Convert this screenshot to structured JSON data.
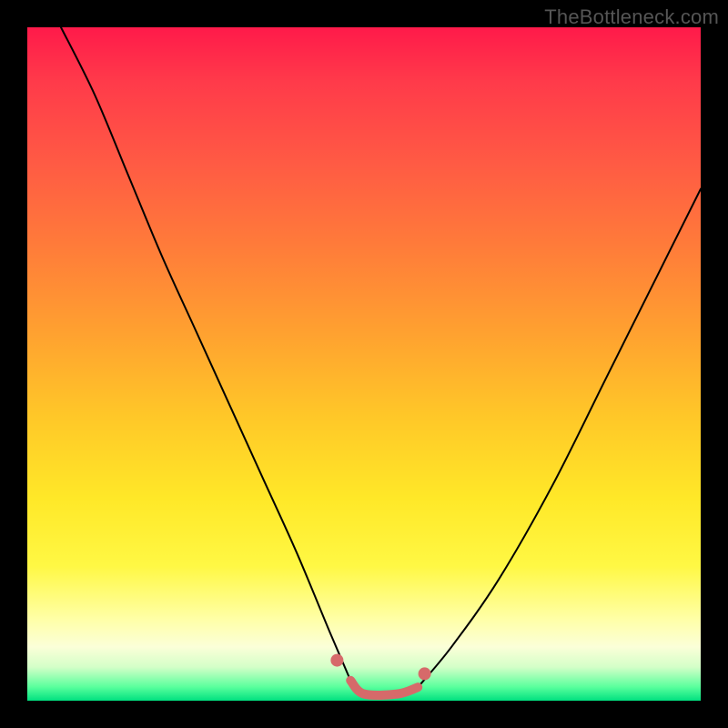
{
  "watermark": "TheBottleneck.com",
  "colors": {
    "frame_bg": "#000000",
    "curve": "#000000",
    "marker": "#d66a6a",
    "watermark": "#555555"
  },
  "chart_data": {
    "type": "line",
    "title": "",
    "xlabel": "",
    "ylabel": "",
    "xlim": [
      0,
      100
    ],
    "ylim": [
      0,
      100
    ],
    "grid": false,
    "legend": false,
    "note": "V-shaped bottleneck curve. y ≈ 100 means large mismatch (red), y ≈ 0 means balanced (green). Values estimated from pixel positions; no numeric axis labels are shown in the source image.",
    "series": [
      {
        "name": "left_branch",
        "x": [
          5,
          10,
          15,
          20,
          25,
          30,
          35,
          40,
          45,
          48
        ],
        "y": [
          100,
          90,
          78,
          66,
          55,
          44,
          33,
          22,
          10,
          3
        ]
      },
      {
        "name": "floor",
        "x": [
          48,
          50,
          55,
          58
        ],
        "y": [
          3,
          1,
          1,
          2
        ]
      },
      {
        "name": "right_branch",
        "x": [
          58,
          63,
          70,
          78,
          86,
          94,
          100
        ],
        "y": [
          2,
          8,
          18,
          32,
          48,
          64,
          76
        ]
      }
    ],
    "markers": [
      {
        "name": "left",
        "x": 46,
        "y": 6
      },
      {
        "name": "mid1",
        "x": 50,
        "y": 1
      },
      {
        "name": "mid2",
        "x": 55,
        "y": 1
      },
      {
        "name": "right",
        "x": 59,
        "y": 4
      }
    ]
  }
}
